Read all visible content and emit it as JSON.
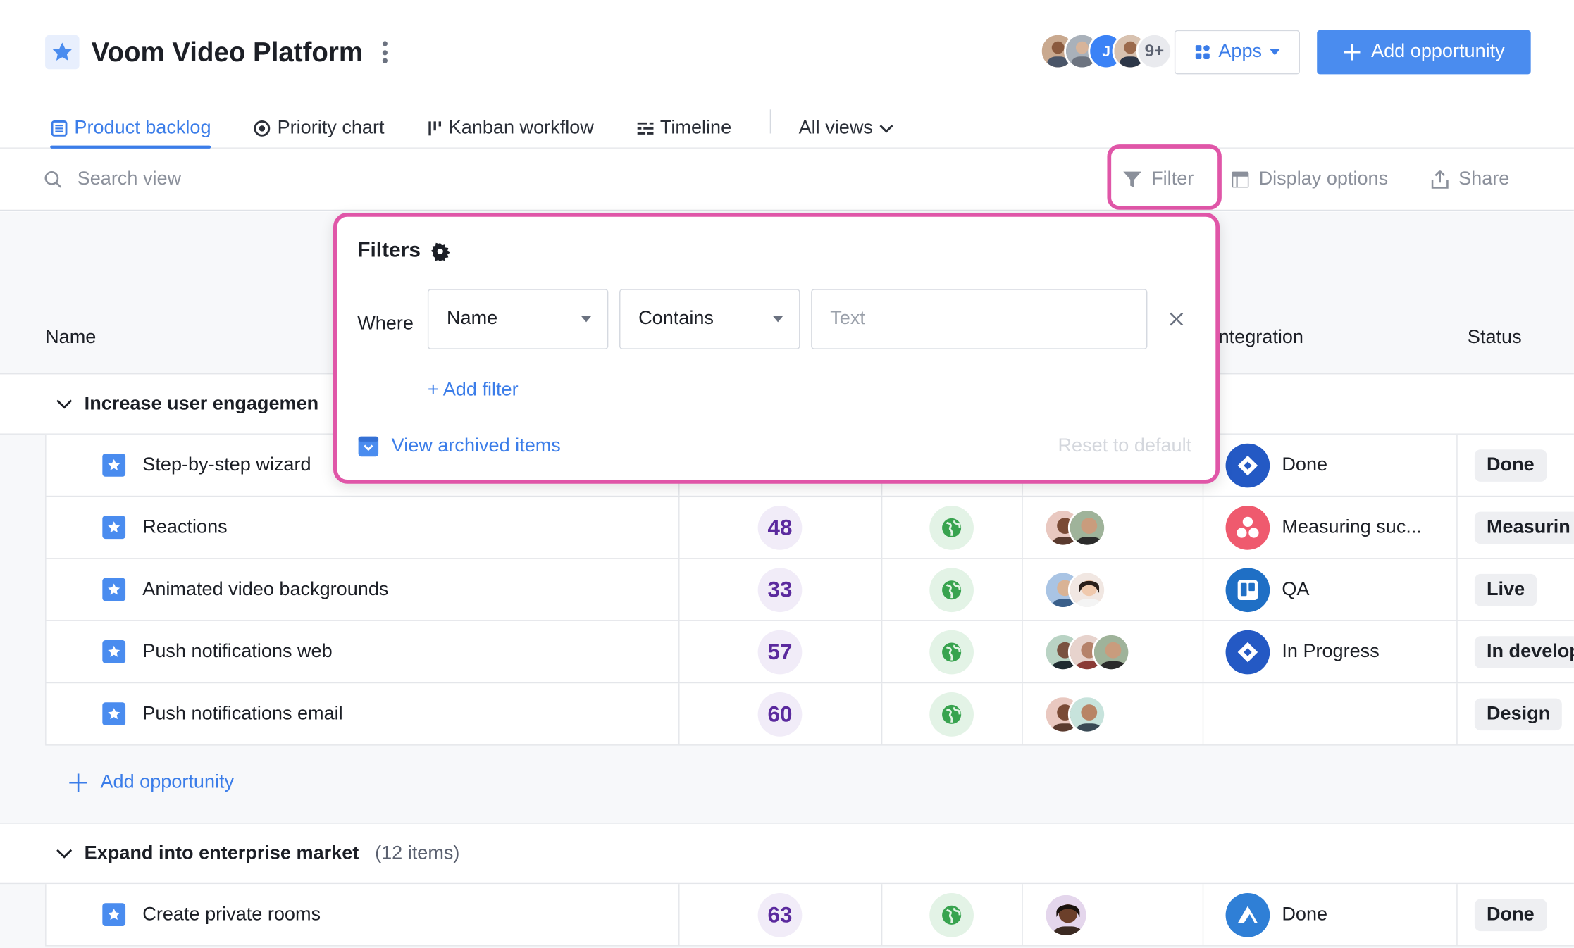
{
  "header": {
    "project_title": "Voom Video Platform",
    "avatar_initial": "J",
    "avatar_more": "9+",
    "apps_label": "Apps",
    "add_opportunity_label": "Add opportunity"
  },
  "tabs": [
    {
      "label": "Product backlog",
      "icon": "list-icon",
      "active": true
    },
    {
      "label": "Priority chart",
      "icon": "target-icon",
      "active": false
    },
    {
      "label": "Kanban workflow",
      "icon": "kanban-icon",
      "active": false
    },
    {
      "label": "Timeline",
      "icon": "timeline-icon",
      "active": false
    }
  ],
  "all_views_label": "All views",
  "toolbar": {
    "search_placeholder": "Search view",
    "filter_label": "Filter",
    "display_options_label": "Display options",
    "share_label": "Share"
  },
  "columns": {
    "name": "Name",
    "integration": "ntegration",
    "status": "Status"
  },
  "groups": [
    {
      "title": "Increase user engagemen",
      "rows": [
        {
          "name": "Step-by-step wizard",
          "score": "",
          "integration_icon": "jira-icon",
          "integration_color": "#2459c4",
          "integration": "Done",
          "status": "Done",
          "people": 1
        },
        {
          "name": "Reactions",
          "score": "48",
          "integration_icon": "dots-icon",
          "integration_color": "#ef5a6e",
          "integration": "Measuring suc...",
          "status": "Measurin",
          "people": 2
        },
        {
          "name": "Animated video backgrounds",
          "score": "33",
          "integration_icon": "trello-icon",
          "integration_color": "#1f6fc5",
          "integration": "QA",
          "status": "Live",
          "people": 2
        },
        {
          "name": "Push notifications web",
          "score": "57",
          "integration_icon": "jira-icon",
          "integration_color": "#2459c4",
          "integration": "In Progress",
          "status": "In develop",
          "people": 3
        },
        {
          "name": "Push notifications email",
          "score": "60",
          "integration_icon": "",
          "integration_color": "",
          "integration": "",
          "status": "Design",
          "people": 2
        }
      ],
      "add_label": "Add opportunity"
    },
    {
      "title": "Expand into enterprise market",
      "count": "(12 items)",
      "rows": [
        {
          "name": "Create private rooms",
          "score": "63",
          "integration_icon": "mountain-icon",
          "integration_color": "#2f7fd6",
          "integration": "Done",
          "status": "Done",
          "people": 1
        }
      ]
    }
  ],
  "filter_popover": {
    "title": "Filters",
    "where_label": "Where",
    "field_value": "Name",
    "operator_value": "Contains",
    "text_placeholder": "Text",
    "add_filter_label": "+ Add filter",
    "view_archived_label": "View archived items",
    "reset_label": "Reset to default"
  },
  "colors": {
    "accent": "#3b7de9",
    "primary_button": "#4a8cef",
    "highlight": "#e056a8",
    "score_text": "#5b2a9e"
  }
}
